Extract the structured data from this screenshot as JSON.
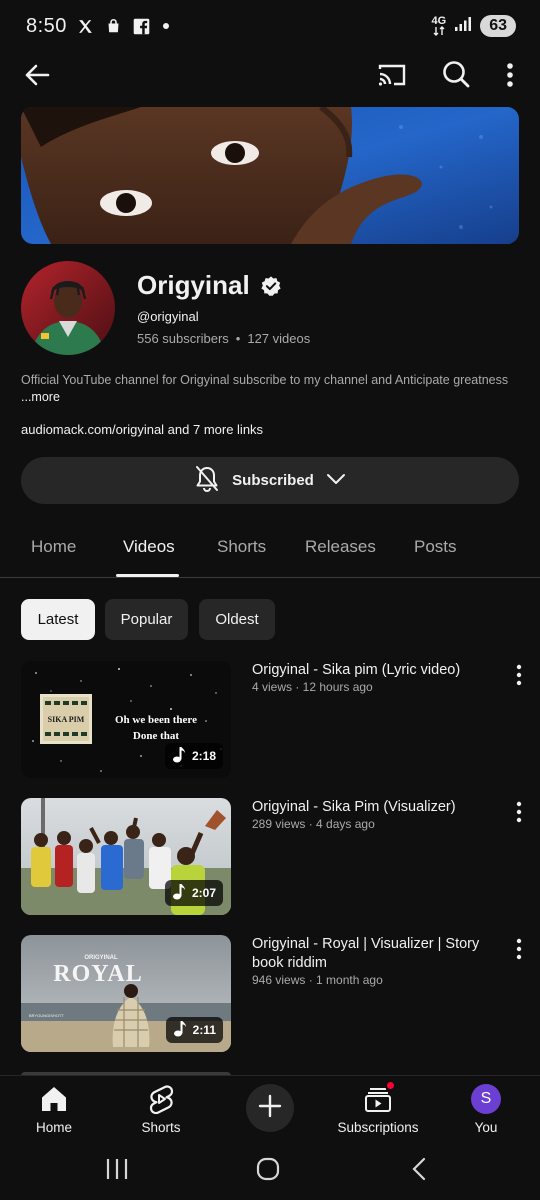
{
  "status_bar": {
    "time": "8:50",
    "network": "4G",
    "battery": "63"
  },
  "channel": {
    "name": "Origyinal",
    "handle": "@origyinal",
    "subscribers": "556 subscribers",
    "separator": "•",
    "videos": "127 videos",
    "description": "Official YouTube channel for Origyinal subscribe to my channel and Anticipate greatness",
    "more_label": "...more",
    "links": "audiomack.com/origyinal and 7 more links"
  },
  "subscribe_button": {
    "label": "Subscribed"
  },
  "tabs": [
    {
      "label": "Home"
    },
    {
      "label": "Videos"
    },
    {
      "label": "Shorts"
    },
    {
      "label": "Releases"
    },
    {
      "label": "Posts"
    }
  ],
  "chips": [
    {
      "label": "Latest"
    },
    {
      "label": "Popular"
    },
    {
      "label": "Oldest"
    }
  ],
  "videos": [
    {
      "title": "Origyinal - Sika pim (Lyric video)",
      "meta": "4 views · 12 hours ago",
      "duration": "2:18",
      "thumb_text_1": "Oh we been there",
      "thumb_text_2": "Done that",
      "thumb_badge": "SIKA PIM"
    },
    {
      "title": "Origyinal - Sika Pim  (Visualizer)",
      "meta": "289 views · 4 days ago",
      "duration": "2:07"
    },
    {
      "title": "Origyinal - Royal  | Visualizer | Story book riddim",
      "meta": "946 views · 1 month ago",
      "duration": "2:11",
      "thumb_text_small": "ORIGYINAL",
      "thumb_text_big": "ROYAL",
      "thumb_credit": "BRYOUNGISHOTT"
    }
  ],
  "bottom_nav": [
    {
      "label": "Home"
    },
    {
      "label": "Shorts"
    },
    {
      "label": "Subscriptions"
    },
    {
      "label": "You",
      "avatar_letter": "S"
    }
  ],
  "colors": {
    "background": "#0f0f0f",
    "surface": "#272727",
    "text_primary": "#f1f1f1",
    "text_secondary": "#aaaaaa",
    "notification_dot": "#ff0033",
    "you_avatar": "#6b3fd1"
  },
  "icons": [
    "back-arrow-icon",
    "cast-icon",
    "search-icon",
    "more-vert-icon",
    "verified-icon",
    "bell-off-icon",
    "chevron-down-icon",
    "music-note-icon",
    "home-icon",
    "shorts-icon",
    "plus-icon",
    "subscriptions-icon",
    "recents-icon",
    "home-circle-icon",
    "back-chevron-icon"
  ]
}
